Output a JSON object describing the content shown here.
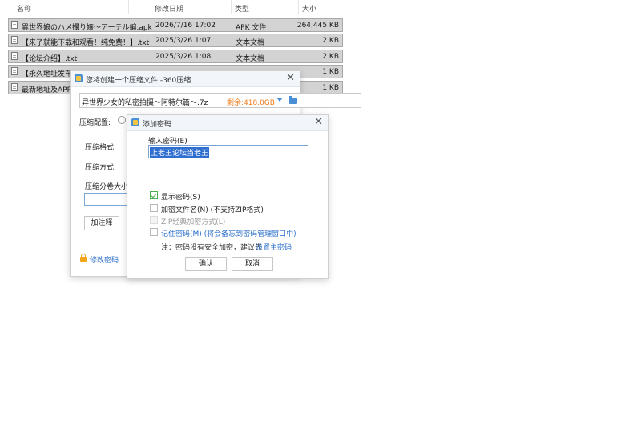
{
  "columns": {
    "name": "名称",
    "date": "修改日期",
    "type": "类型",
    "size": "大小"
  },
  "files": [
    {
      "name": "異世界娘のハメ撮り嬢～アーテル編.apk",
      "date": "2026/7/16 17:02",
      "type": "APK 文件",
      "size": "264,445 KB"
    },
    {
      "name": "【来了就能下载和观看！纯免费！】.txt",
      "date": "2025/3/26 1:07",
      "type": "文本文档",
      "size": "2 KB"
    },
    {
      "name": "【论坛介绍】.txt",
      "date": "2025/3/26 1:08",
      "type": "文本文档",
      "size": "2 KB"
    },
    {
      "name": "【永久地址发布页",
      "date": "",
      "type": "",
      "size": "1 KB"
    },
    {
      "name": "最新地址及APP下",
      "date": "",
      "type": "",
      "size": "1 KB"
    }
  ],
  "compress_window": {
    "title": "您将创建一个压缩文件 -360压缩",
    "path": "异世界少女的私密拍摄～阿特尔篇～.7z",
    "space": "剩余:418.0GB",
    "config_label": "压缩配置:",
    "format_label": "压缩格式:",
    "method_label": "压缩方式:",
    "split_label": "压缩分卷大小:",
    "comment_button": "加注释",
    "change_password": "修改密码"
  },
  "password_dialog": {
    "title": "添加密码",
    "input_label": "输入密码(E)",
    "password_value": "上老王论坛当老王",
    "options": {
      "show_password": "显示密码(S)",
      "encrypt_names": "加密文件名(N) (不支持ZIP格式)",
      "zip_classic": "ZIP经典加密方式(L)",
      "remember": "记住密码(M) (将会备忘到密码管理窗口中)"
    },
    "note": "注：密码没有安全加密，建议先",
    "note_link": "设置主密码",
    "ok": "确认",
    "cancel": "取消"
  },
  "colors": {
    "accent": "#2a6fc9",
    "space": "#f07c1c",
    "check": "#4caf50"
  }
}
